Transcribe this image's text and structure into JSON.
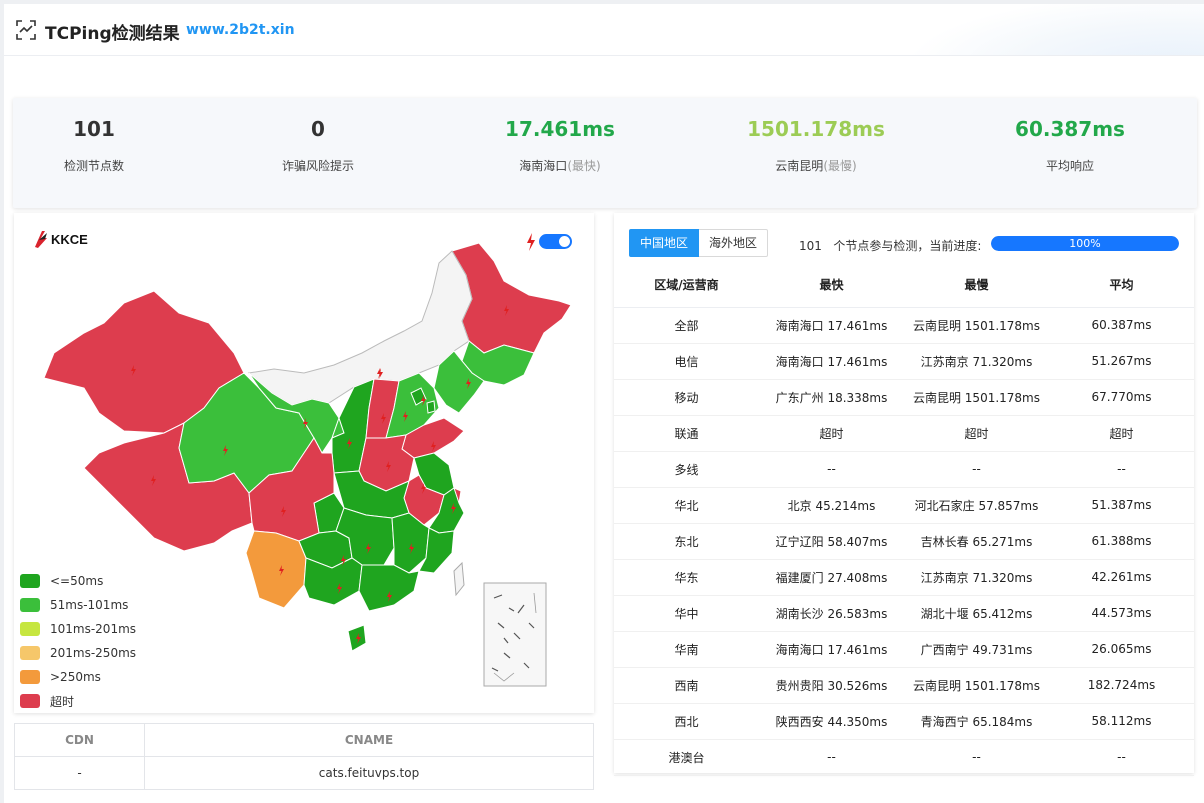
{
  "header": {
    "title": "TCPing检测结果",
    "site": "www.2b2t.xin"
  },
  "summary": {
    "nodes": {
      "value": "101",
      "label": "检测节点数"
    },
    "fraud": {
      "value": "0",
      "label": "诈骗风险提示"
    },
    "fastest": {
      "value": "17.461ms",
      "label": "海南海口",
      "note": "(最快)"
    },
    "slowest": {
      "value": "1501.178ms",
      "label": "云南昆明",
      "note": "(最慢)"
    },
    "average": {
      "value": "60.387ms",
      "label": "平均响应"
    }
  },
  "map": {
    "logo": "KKCE",
    "toggle_on": true,
    "legend": [
      {
        "label": "<=50ms",
        "color": "#1fa51f"
      },
      {
        "label": "51ms-101ms",
        "color": "#3bbf3b"
      },
      {
        "label": "101ms-201ms",
        "color": "#c6e640"
      },
      {
        "label": "201ms-250ms",
        "color": "#f6c76a"
      },
      {
        "label": ">250ms",
        "color": "#f39a3c"
      },
      {
        "label": "超时",
        "color": "#dd3d4e"
      }
    ]
  },
  "cdn": {
    "headers": [
      "CDN",
      "CNAME"
    ],
    "rows": [
      [
        "-",
        "cats.feituvps.top"
      ]
    ]
  },
  "right": {
    "tabs": [
      "中国地区",
      "海外地区"
    ],
    "node_count": "101",
    "node_text": "个节点参与检测，当前进度:",
    "progress": 100,
    "progress_label": "100%",
    "columns": [
      "区域/运营商",
      "最快",
      "最慢",
      "平均"
    ],
    "rows": [
      [
        "全部",
        "海南海口 17.461ms",
        "云南昆明 1501.178ms",
        "60.387ms"
      ],
      [
        "电信",
        "海南海口 17.461ms",
        "江苏南京 71.320ms",
        "51.267ms"
      ],
      [
        "移动",
        "广东广州 18.338ms",
        "云南昆明 1501.178ms",
        "67.770ms"
      ],
      [
        "联通",
        "超时",
        "超时",
        "超时"
      ],
      [
        "多线",
        "--",
        "--",
        "--"
      ],
      [
        "华北",
        "北京 45.214ms",
        "河北石家庄 57.857ms",
        "51.387ms"
      ],
      [
        "东北",
        "辽宁辽阳 58.407ms",
        "吉林长春 65.271ms",
        "61.388ms"
      ],
      [
        "华东",
        "福建厦门 27.408ms",
        "江苏南京 71.320ms",
        "42.261ms"
      ],
      [
        "华中",
        "湖南长沙 26.583ms",
        "湖北十堰 65.412ms",
        "44.573ms"
      ],
      [
        "华南",
        "海南海口 17.461ms",
        "广西南宁 49.731ms",
        "26.065ms"
      ],
      [
        "西南",
        "贵州贵阳 30.526ms",
        "云南昆明 1501.178ms",
        "182.724ms"
      ],
      [
        "西北",
        "陕西西安 44.350ms",
        "青海西宁 65.184ms",
        "58.112ms"
      ],
      [
        "港澳台",
        "--",
        "--",
        "--"
      ]
    ]
  },
  "colors": {
    "fastest": "#22a84a",
    "slowest": "#9ccc55",
    "average": "#22a84a",
    "accent": "#2196f3",
    "timeout": "#e02020"
  }
}
